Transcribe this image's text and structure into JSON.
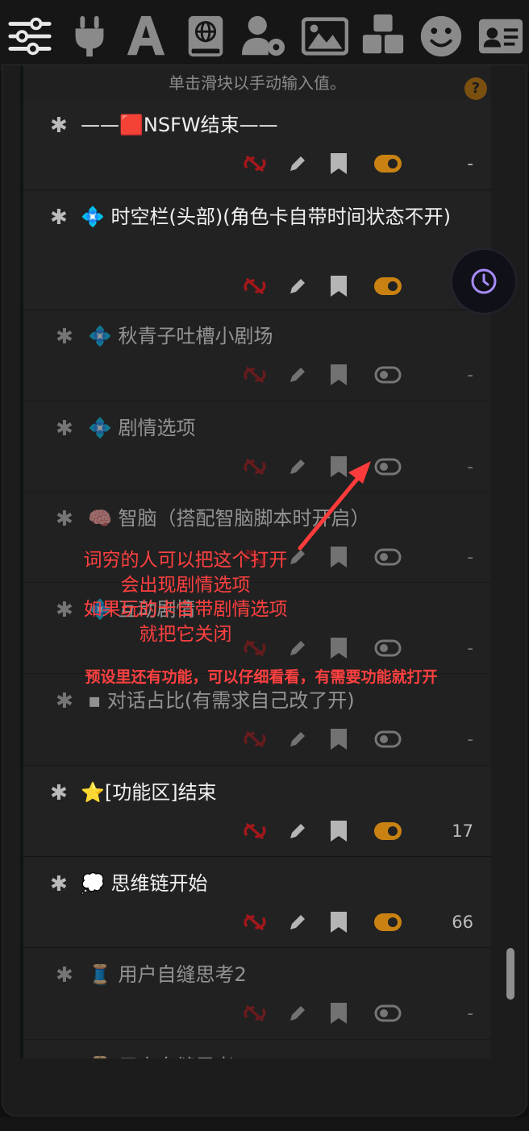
{
  "toolbar": {
    "icons": [
      "sliders-icon",
      "plug-icon",
      "font-icon",
      "book-globe-icon",
      "user-gear-icon",
      "image-icon",
      "cubes-icon",
      "smile-icon",
      "id-card-icon"
    ]
  },
  "hint": {
    "text": "单击滑块以手动输入值。",
    "help_label": "?"
  },
  "entries": [
    {
      "title": "——🟥NSFW结束——",
      "enabled": true,
      "count": "-"
    },
    {
      "title": "💠 时空栏(头部)(角色卡自带时间状态不开)",
      "enabled": true,
      "count": "-"
    },
    {
      "title": "💠 秋青子吐槽小剧场",
      "enabled": false,
      "count": "-"
    },
    {
      "title": "💠 剧情选项",
      "enabled": false,
      "count": "-"
    },
    {
      "title": "🧠 智脑（搭配智脑脚本时开启）",
      "enabled": false,
      "count": "-"
    },
    {
      "title": "💠 互动剧情",
      "enabled": false,
      "count": "-"
    },
    {
      "title": "▪ 对话占比(有需求自己改了开)",
      "enabled": false,
      "count": "-"
    },
    {
      "title": "⭐[功能区]结束",
      "enabled": true,
      "count": "17"
    },
    {
      "title": "💭 思维链开始",
      "enabled": true,
      "count": "66"
    },
    {
      "title": "🧵 用户自缝思考2",
      "enabled": false,
      "count": "-"
    },
    {
      "title": "🧵 用户自缝思考",
      "enabled": false,
      "count": "-"
    }
  ],
  "annotations": {
    "line1": "词穷的人可以把这个打开",
    "line2": "会出现剧情选项",
    "line3": "如果玩的卡自带剧情选项",
    "line4": "就把它关闭",
    "line5": "预设里还有功能，可以仔细看看，有需要功能就打开"
  },
  "colors": {
    "accent": "#c98212",
    "link_red": "#a3171b",
    "annotation_red": "#ff4040",
    "clock_purple": "#a78bfa"
  }
}
